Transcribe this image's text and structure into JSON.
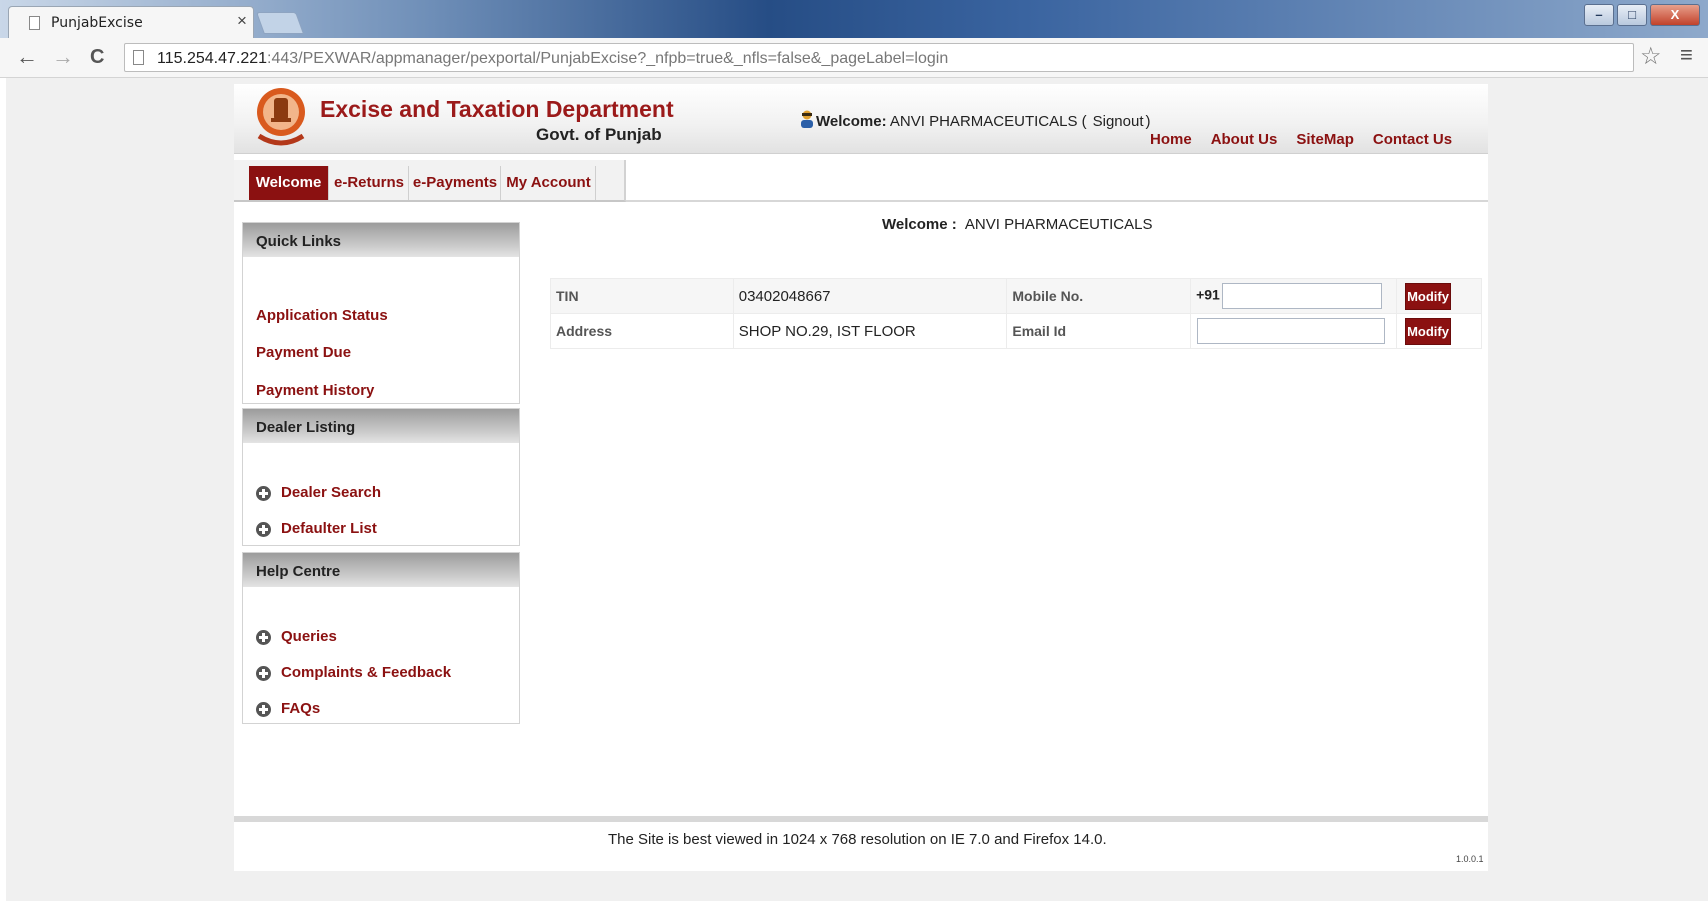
{
  "browser": {
    "tab_title": "PunjabExcise",
    "tab_close": "×",
    "url_host": "115.254.47.221",
    "url_rest": ":443/PEXWAR/appmanager/pexportal/PunjabExcise?_nfpb=true&_nfls=false&_pageLabel=login",
    "back": "←",
    "forward": "→",
    "reload": "C",
    "star": "☆",
    "menu": "≡",
    "min": "–",
    "max": "□",
    "close": "X"
  },
  "header": {
    "dept_title": "Excise and Taxation Department",
    "dept_sub": "Govt. of Punjab",
    "welcome_label": "Welcome:",
    "welcome_user": "ANVI PHARMACEUTICALS (",
    "signout": "Signout",
    "close_paren": ")",
    "links": [
      "Home",
      "About Us",
      "SiteMap",
      "Contact Us"
    ]
  },
  "nav": {
    "tabs": [
      "Welcome",
      "e-Returns",
      "e-Payments",
      "My Account"
    ]
  },
  "sidebar": {
    "quick_links_title": "Quick Links",
    "quick_links": [
      "Application Status",
      "Payment Due",
      "Payment History"
    ],
    "dealer_title": "Dealer Listing",
    "dealer_links": [
      "Dealer Search",
      "Defaulter List"
    ],
    "help_title": "Help Centre",
    "help_links": [
      "Queries",
      "Complaints & Feedback",
      "FAQs"
    ]
  },
  "main": {
    "welcome_label": "Welcome :",
    "welcome_user": "ANVI PHARMACEUTICALS",
    "tin_label": "TIN",
    "tin_value": "03402048667",
    "mobile_label": "Mobile No.",
    "mobile_prefix": "+91",
    "mobile_value": "",
    "address_label": "Address",
    "address_value": "SHOP NO.29, IST FLOOR",
    "email_label": "Email Id",
    "email_value": "",
    "modify_label": "Modify"
  },
  "footer": {
    "text": "The Site is best viewed in 1024 x 768 resolution on IE 7.0 and Firefox 14.0.",
    "version": "1.0.0.1"
  },
  "colors": {
    "brand_red": "#8b1111",
    "title_red": "#9b1a1a"
  }
}
